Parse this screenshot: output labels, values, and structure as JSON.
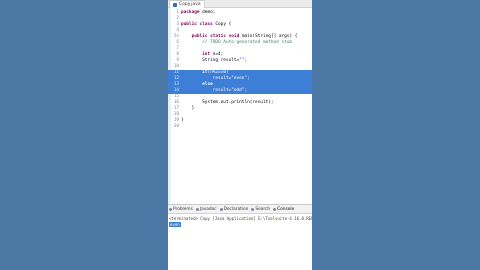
{
  "editor_tab": {
    "label": "Copy.java"
  },
  "code_lines": [
    {
      "n": "1",
      "text": "package demo;"
    },
    {
      "n": "2",
      "text": ""
    },
    {
      "n": "3",
      "text": "public class Copy {"
    },
    {
      "n": "4",
      "text": ""
    },
    {
      "n": "5⊖",
      "text": "    public static void main(String[] args) {"
    },
    {
      "n": "6",
      "text": "        // TODO Auto-generated method stub"
    },
    {
      "n": "7",
      "text": ""
    },
    {
      "n": "8",
      "text": "        int n=4;"
    },
    {
      "n": "9",
      "text": "        String result=\"\";"
    },
    {
      "n": "10",
      "text": ""
    },
    {
      "n": "11",
      "text": "        if(n%2==0)"
    },
    {
      "n": "12",
      "text": "            result=\"even\";"
    },
    {
      "n": "13",
      "text": "        else"
    },
    {
      "n": "14",
      "text": "            result=\"odd\";"
    },
    {
      "n": "15",
      "text": ""
    },
    {
      "n": "16",
      "text": "        System.out.println(result);"
    },
    {
      "n": "17",
      "text": "    }"
    },
    {
      "n": "18",
      "text": ""
    },
    {
      "n": "19",
      "text": "}"
    },
    {
      "n": "20",
      "text": ""
    }
  ],
  "selected_lines": [
    "11",
    "12",
    "13",
    "14"
  ],
  "bottom_tabs": [
    "Problems",
    "Javadoc",
    "Declaration",
    "Search",
    "Console"
  ],
  "active_bottom_tab": "Console",
  "console": {
    "status": "<terminated> Copy [Java Application] E:\\Toolsuite-4.16.0.RELEASE\\plugins",
    "output": "even"
  },
  "colors": {
    "background": "#4a77a3",
    "selection": "#3d7fd6",
    "keyword": "#7f0055",
    "comment": "#3f7f5f",
    "string": "#2a00ff"
  }
}
